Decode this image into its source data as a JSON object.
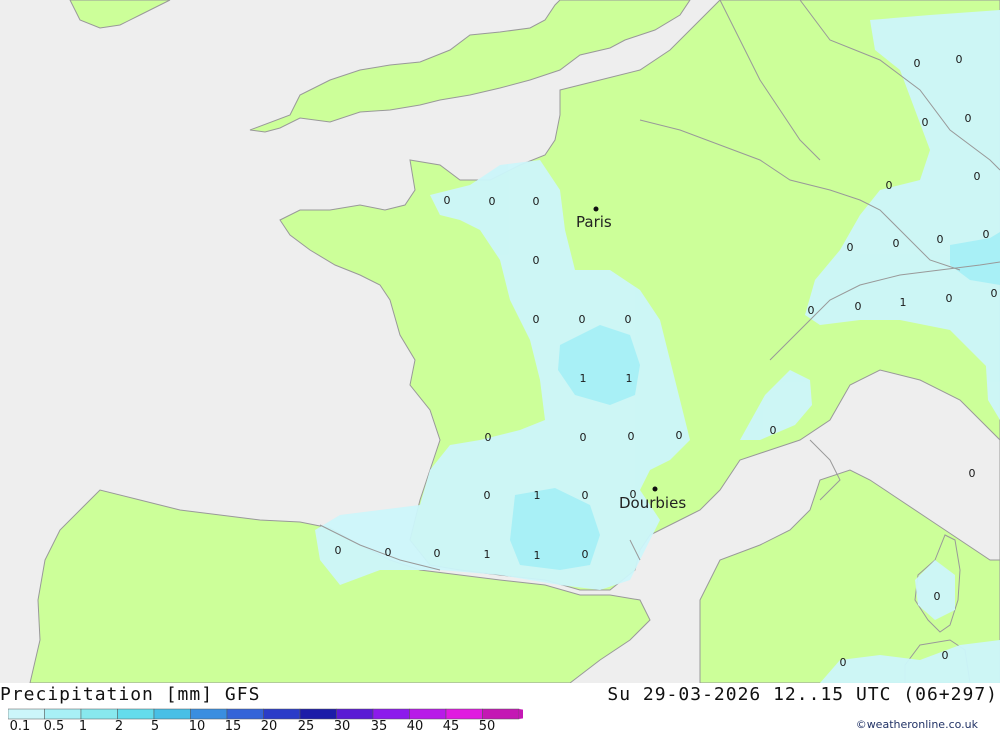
{
  "title": "Precipitation [mm] GFS",
  "datetime": "Su 29-03-2026 12..15 UTC (06+297)",
  "credit": "©weatheronline.co.uk",
  "colors": {
    "sea": "#eeeeee",
    "land": "#ccff99",
    "border": "#999999",
    "light_precip": "#ccf6fa",
    "mid_precip": "#a8f0f6"
  },
  "legend": {
    "ticks": [
      "0.1",
      "0.5",
      "1",
      "2",
      "5",
      "10",
      "15",
      "20",
      "25",
      "30",
      "35",
      "40",
      "45",
      "50"
    ],
    "colors": [
      "#ccf6fa",
      "#a8f0f6",
      "#88e8ee",
      "#64dcec",
      "#48bfe6",
      "#3a8ee0",
      "#3464d8",
      "#2a3cc8",
      "#1c1ca8",
      "#5a1ad4",
      "#8c1aec",
      "#b81ae8",
      "#e01ae0",
      "#c418b4"
    ]
  },
  "cities": [
    {
      "name": "Paris"
    },
    {
      "name": "Dourbies"
    }
  ],
  "precip_labels": [
    "0",
    "0",
    "0",
    "0",
    "0",
    "0",
    "0",
    "1",
    "1",
    "0",
    "0",
    "0",
    "0",
    "0",
    "1",
    "0",
    "0",
    "0",
    "0",
    "0",
    "1",
    "1",
    "0",
    "0",
    "0",
    "0",
    "0",
    "0",
    "0",
    "0",
    "0",
    "0",
    "0",
    "0",
    "0",
    "1",
    "0",
    "0",
    "0",
    "0"
  ]
}
